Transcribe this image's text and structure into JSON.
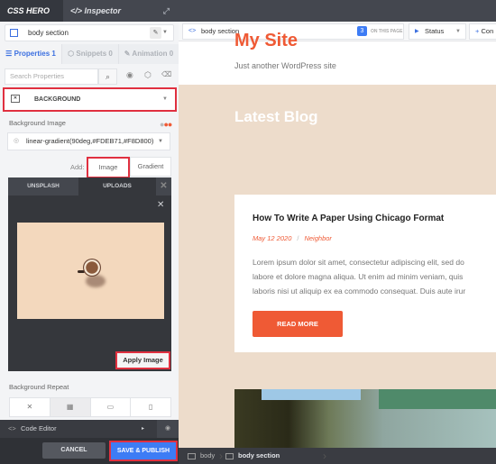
{
  "app": {
    "logo": "CSS HERO",
    "inspector_tab": "Inspector",
    "expand_icon": "⤢"
  },
  "selector": {
    "label": "body section",
    "edit_icon": "✎",
    "dropdown_icon": "▼"
  },
  "property_tabs": [
    {
      "label": "Properties 1",
      "icon": "☰",
      "active": true
    },
    {
      "label": "Snippets 0",
      "icon": "⬡",
      "active": false
    },
    {
      "label": "Animation 0",
      "icon": "✎",
      "active": false
    }
  ],
  "search": {
    "placeholder": "Search Properties",
    "search_icon": "⌕",
    "eye_icon": "◉",
    "cube_icon": "⬡",
    "trash_icon": "🗑"
  },
  "section_select": {
    "label": "BACKGROUND",
    "icon": "▣",
    "dropdown_icon": "▼"
  },
  "background_image": {
    "label": "Background Image",
    "value": "linear-gradient(90deg,#FDEB71,#F8D800)",
    "add_label": "Add:",
    "image_button": "Image",
    "gradient_button": "Gradient"
  },
  "media_panel": {
    "tabs": [
      "UNSPLASH",
      "UPLOADS"
    ],
    "close_icon": "✕",
    "apply_button": "Apply Image"
  },
  "background_repeat": {
    "label": "Background Repeat",
    "options": [
      "✕",
      "▦",
      "▭",
      "▯"
    ],
    "selected_index": 1
  },
  "code_editor": {
    "label": "Code Editor",
    "icon": "<>",
    "arrow": "▸",
    "eye_icon": "◉"
  },
  "footer": {
    "cancel": "CANCEL",
    "save": "SAVE & PUBLISH"
  },
  "toolbar": {
    "selector": "body section",
    "count": "3",
    "on_this_page": "ON THIS PAGE",
    "status": "Status",
    "next_label": "Con"
  },
  "site": {
    "title": "My Site",
    "tagline": "Just another WordPress site",
    "section_title": "Latest Blog",
    "post": {
      "title": "How To Write A Paper Using Chicago Format",
      "date": "May 12 2020",
      "separator": "/",
      "category": "Neighbor",
      "excerpt_lines": [
        "Lorem ipsum dolor sit amet, consectetur adipiscing elit, sed do",
        "labore et dolore magna aliqua. Ut enim ad minim veniam, quis",
        "laboris nisi ut aliquip ex ea commodo consequat. Duis aute irur"
      ],
      "button": "READ MORE"
    }
  },
  "breadcrumb": [
    "body",
    "body section"
  ],
  "colors": {
    "accent": "#3d7cf5",
    "highlight": "#e03040",
    "brand_orange": "#ef5a35",
    "peach_bg": "#eddccb"
  }
}
